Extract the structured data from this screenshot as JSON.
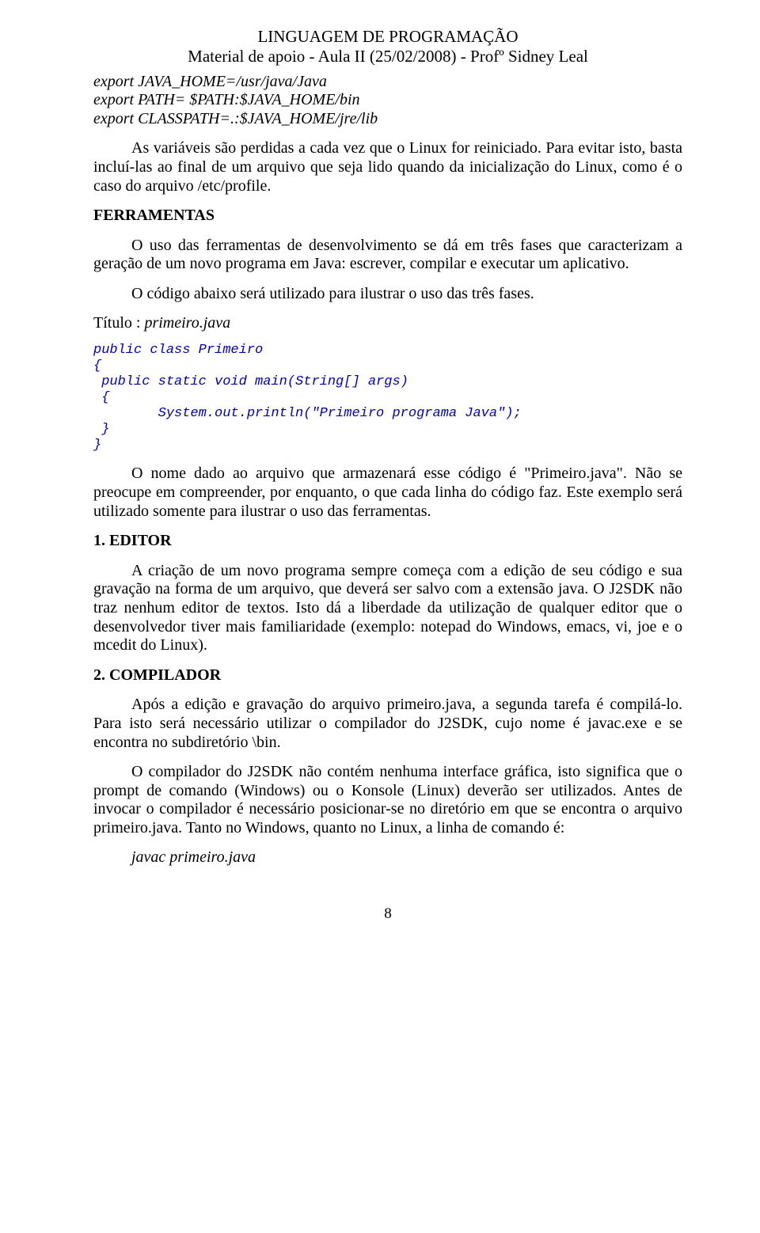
{
  "header": {
    "line1": "LINGUAGEM DE PROGRAMAÇÃO",
    "line2": "Material de apoio - Aula II (25/02/2008) - Profº Sidney Leal"
  },
  "env": {
    "l1": "export JAVA_HOME=/usr/java/Java",
    "l2": "export PATH= $PATH:$JAVA_HOME/bin",
    "l3": "export CLASSPATH=.:$JAVA_HOME/jre/lib"
  },
  "p_env": "As variáveis são perdidas a cada vez que o Linux for reiniciado. Para evitar isto, basta incluí-las ao final de um arquivo que seja lido quando da inicialização do Linux, como é o caso do arquivo /etc/profile.",
  "h_ferr": "FERRAMENTAS",
  "p_ferr1": "O uso das ferramentas de desenvolvimento se dá em três fases que caracterizam a geração de um novo programa em Java: escrever, compilar e executar um aplicativo.",
  "p_ferr2": "O código abaixo será utilizado para ilustrar o uso das três fases.",
  "title_prefix": "Título : ",
  "title_file": "primeiro.java",
  "code": {
    "l1": "public class Primeiro",
    "l2": "{",
    "l3": " public static void main(String[] args)",
    "l4": " {",
    "l5": "        System.out.println(\"Primeiro programa Java\");",
    "l6": " }",
    "l7": "}"
  },
  "p_nome": "O nome dado ao arquivo que armazenará esse código é \"Primeiro.java\". Não se preocupe em compreender, por enquanto, o que cada linha do código faz. Este exemplo será utilizado somente para ilustrar o uso das ferramentas.",
  "h_editor": "1. EDITOR",
  "p_editor": "A criação de um novo programa sempre começa com a edição de seu código e sua gravação na forma de um arquivo, que deverá ser salvo com a extensão java. O J2SDK não traz nenhum editor de textos. Isto dá a liberdade da utilização de qualquer editor que o desenvolvedor tiver mais familiaridade (exemplo: notepad do Windows, emacs, vi, joe e o mcedit do Linux).",
  "h_comp": "2. COMPILADOR",
  "p_comp1": "Após a edição e gravação do arquivo primeiro.java, a segunda tarefa é compilá-lo. Para isto será necessário utilizar o compilador do J2SDK, cujo nome é javac.exe e se encontra no subdiretório \\bin.",
  "p_comp2": "O compilador do J2SDK não contém nenhuma interface gráfica, isto significa que o prompt de comando (Windows) ou o Konsole (Linux) deverão ser utilizados. Antes de invocar o compilador é necessário posicionar-se no diretório em que se encontra o arquivo primeiro.java. Tanto no Windows, quanto no Linux, a linha de comando é:",
  "cmd": "javac   primeiro.java",
  "page_number": "8"
}
